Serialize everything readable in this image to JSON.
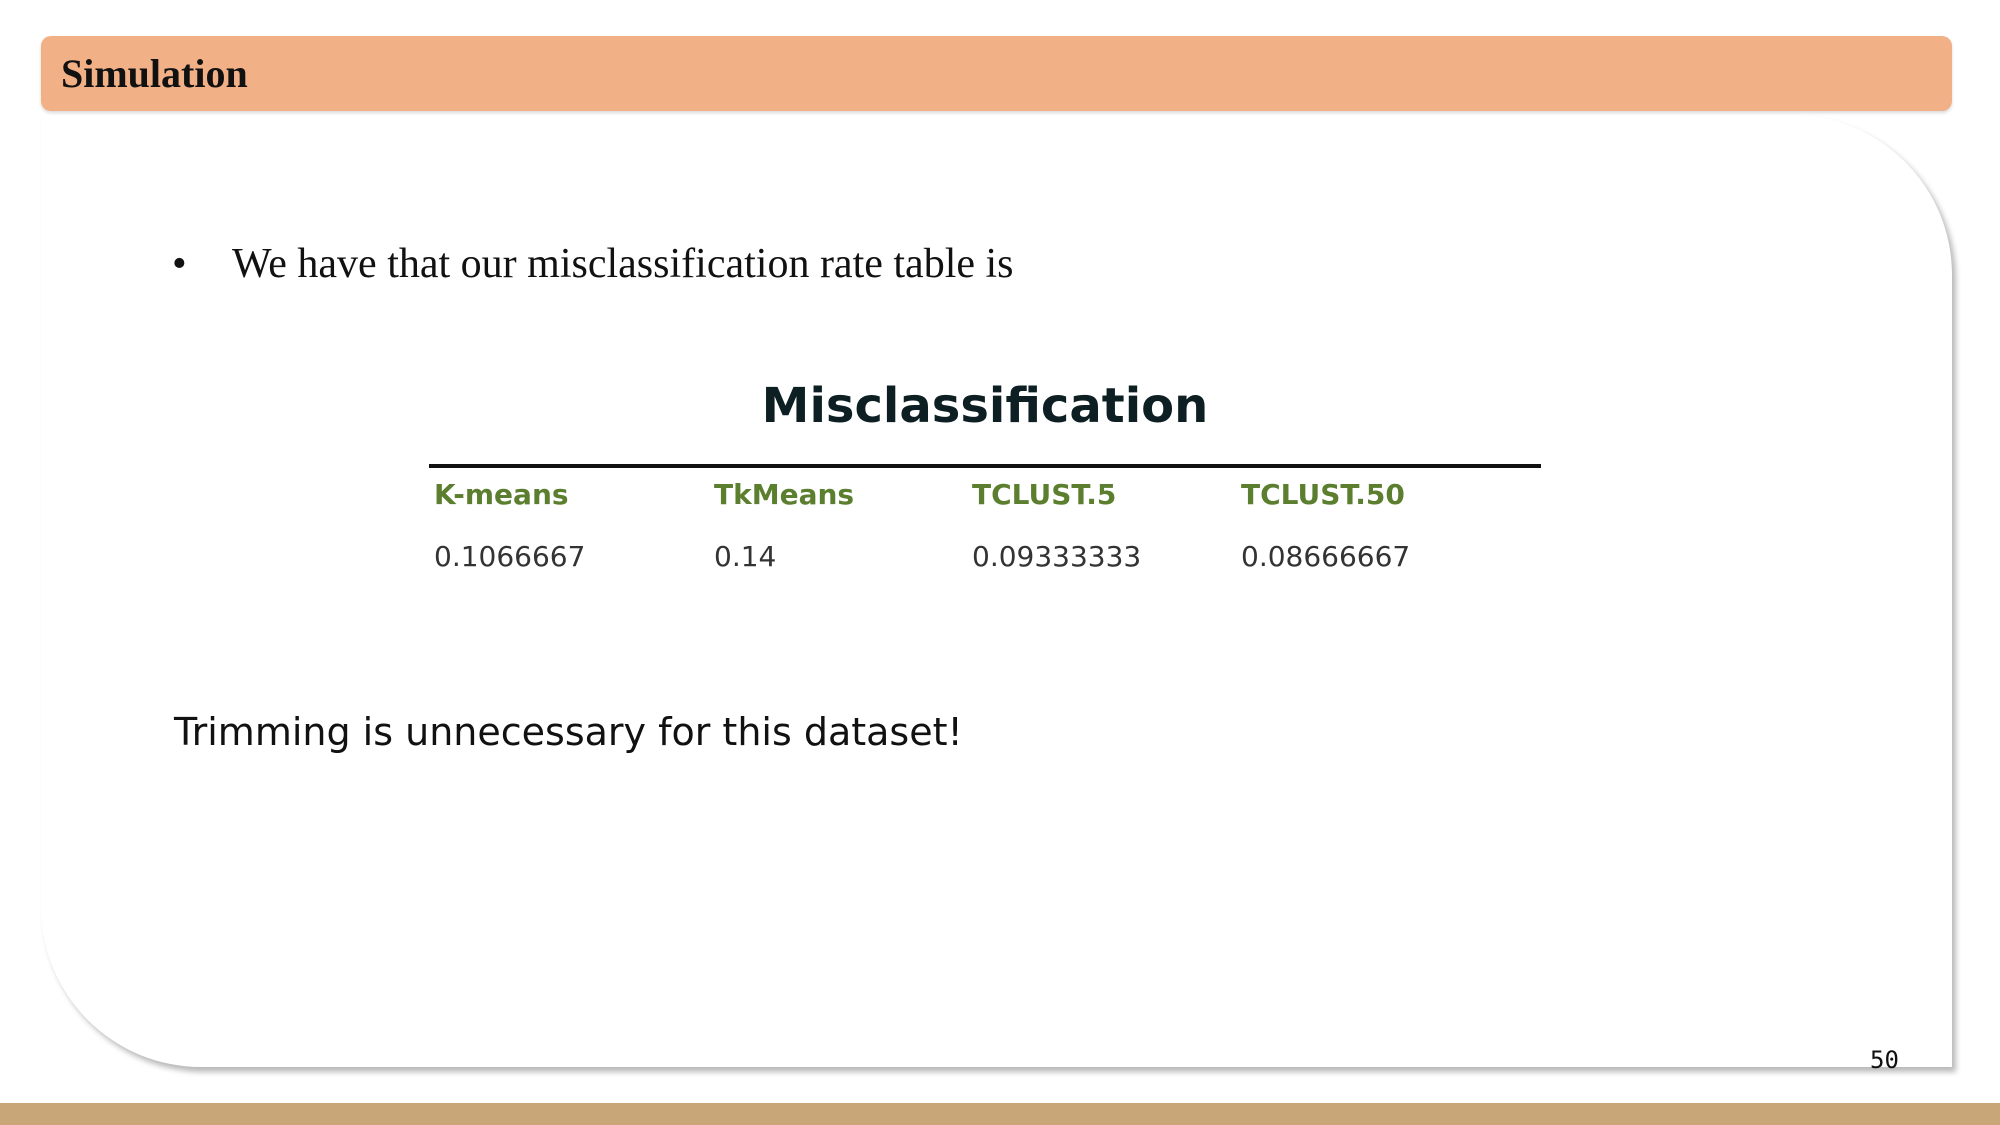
{
  "header": {
    "title": "Simulation"
  },
  "body": {
    "bullet": "We have that our misclassification rate table is",
    "table": {
      "title": "Misclassification",
      "columns": [
        "K-means",
        "TkMeans",
        "TCLUST.5",
        "TCLUST.50"
      ],
      "rows": [
        [
          "0.1066667",
          "0.14",
          "0.09333333",
          "0.08666667"
        ]
      ]
    },
    "note": "Trimming is unnecessary for this dataset!"
  },
  "footer": {
    "page_number": "50"
  },
  "colors": {
    "header_bg": "#f2b086",
    "column_header": "#5b7f2e",
    "bottom_bar": "#c9a677"
  }
}
